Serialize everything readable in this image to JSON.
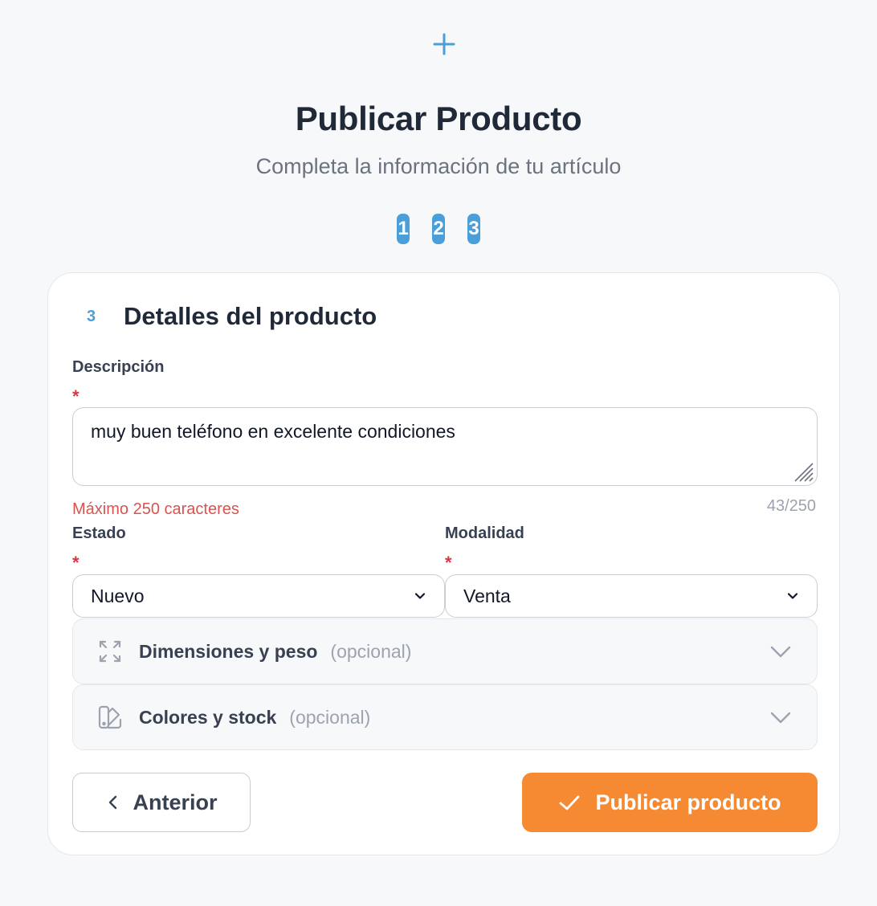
{
  "header": {
    "title": "Publicar Producto",
    "subtitle": "Completa la información de tu artículo",
    "plus_icon": "plus-icon"
  },
  "steps": [
    {
      "label": "1"
    },
    {
      "label": "2"
    },
    {
      "label": "3"
    }
  ],
  "section": {
    "number": "3",
    "title": "Detalles del producto"
  },
  "description": {
    "label": "Descripción",
    "required": "*",
    "value": "muy buen teléfono en excelente condiciones",
    "error": "Máximo 250 caracteres",
    "counter": "43/250"
  },
  "estado": {
    "label": "Estado",
    "required": "*",
    "selected": "Nuevo"
  },
  "modalidad": {
    "label": "Modalidad",
    "required": "*",
    "selected": "Venta"
  },
  "accordions": [
    {
      "title": "Dimensiones y peso",
      "optional": "(opcional)",
      "icon": "expand-icon"
    },
    {
      "title": "Colores y stock",
      "optional": "(opcional)",
      "icon": "swatch-icon"
    }
  ],
  "buttons": {
    "previous": "Anterior",
    "publish": "Publicar producto"
  },
  "colors": {
    "accent_blue": "#4a9fd8",
    "publish_orange": "#f58a33",
    "error_red": "#d9534f"
  }
}
